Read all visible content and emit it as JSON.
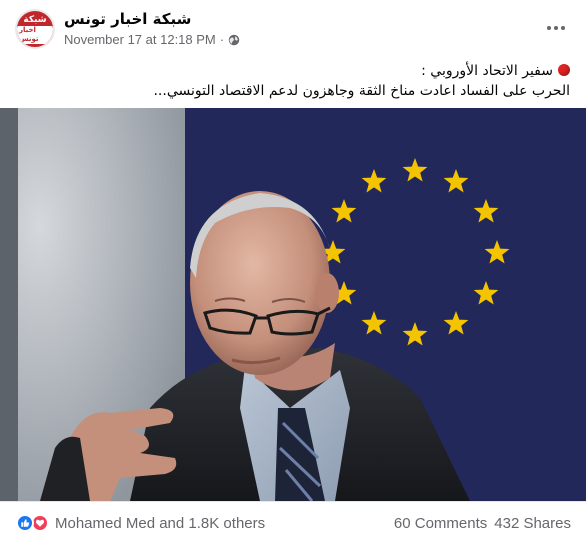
{
  "post": {
    "page_name": "شبكة اخبار تونس",
    "avatar_text_top": "شبكة",
    "avatar_text_bottom": "اخبار تونس",
    "timestamp": "November 17 at 12:18 PM",
    "separator": "·",
    "audience_icon": "globe-icon",
    "more_icon": "more-options-icon",
    "caption_line1": "سفير الاتحاد الأوروبي :",
    "caption_line2": "الحرب على الفساد اعادت مناخ الثقة وجاهزون لدعم الاقتصاد التونسي..."
  },
  "footer": {
    "reaction_icons": [
      "like-icon",
      "love-icon"
    ],
    "reactors": "Mohamed Med and 1.8K others",
    "comments": "60 Comments",
    "shares": "432 Shares"
  },
  "colors": {
    "brand_red": "#c0272d",
    "link_blue": "#1877f2",
    "love_red": "#f33e58",
    "secondary_text": "#65676b",
    "eu_blue": "#23285a",
    "eu_star": "#f5c400"
  }
}
